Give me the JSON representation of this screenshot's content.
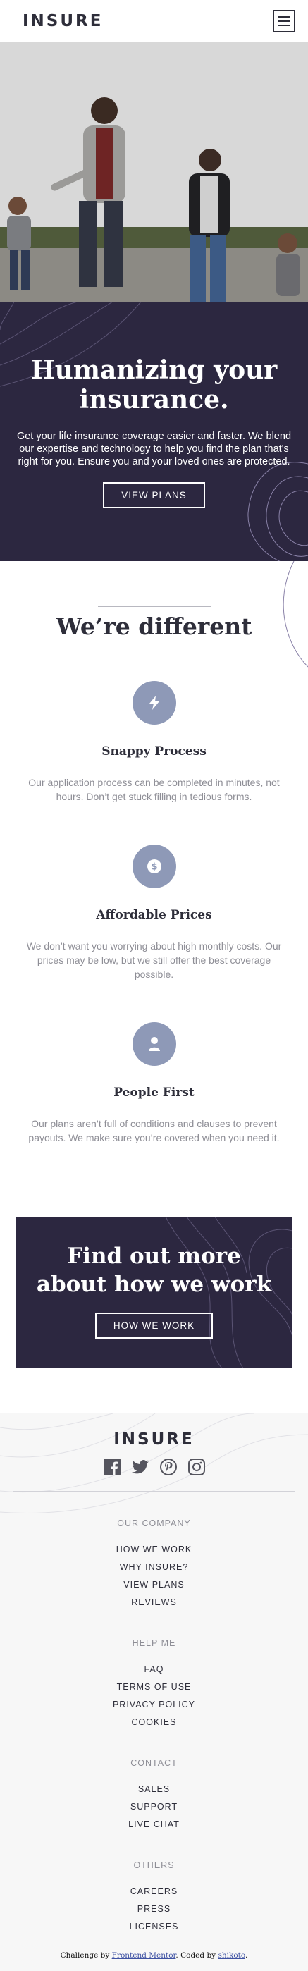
{
  "header": {
    "logo": "INSURE",
    "menu_icon": "hamburger-icon"
  },
  "hero": {
    "title": "Humanizing your insurance.",
    "text": "Get your life insurance coverage easier and faster. We blend our expertise and technology to help you find the plan that's right for you. Ensure you and your loved ones are protected.",
    "button": "VIEW PLANS"
  },
  "different": {
    "title": "We’re different",
    "features": [
      {
        "icon": "lightning-icon",
        "title": "Snappy Process",
        "text": "Our application process can be completed in minutes, not hours. Don’t get stuck filling in tedious forms."
      },
      {
        "icon": "dollar-coin-icon",
        "title": "Affordable Prices",
        "text": "We don’t want you worrying about high monthly costs. Our prices may be low, but we still offer the best coverage possible."
      },
      {
        "icon": "person-icon",
        "title": "People First",
        "text": "Our plans aren’t full of conditions and clauses to prevent payouts. We make sure you’re covered when you need it."
      }
    ]
  },
  "cta": {
    "title": "Find out more about how we work",
    "button": "HOW WE WORK"
  },
  "footer": {
    "logo": "INSURE",
    "socials": [
      "facebook-icon",
      "twitter-icon",
      "pinterest-icon",
      "instagram-icon"
    ],
    "groups": [
      {
        "title": "OUR COMPANY",
        "links": [
          "HOW WE WORK",
          "WHY INSURE?",
          "VIEW PLANS",
          "REVIEWS"
        ]
      },
      {
        "title": "HELP ME",
        "links": [
          "FAQ",
          "TERMS OF USE",
          "PRIVACY POLICY",
          "COOKIES"
        ]
      },
      {
        "title": "CONTACT",
        "links": [
          "SALES",
          "SUPPORT",
          "LIVE CHAT"
        ]
      },
      {
        "title": "OTHERS",
        "links": [
          "CAREERS",
          "PRESS",
          "LICENSES"
        ]
      }
    ],
    "attribution": {
      "prefix": "Challenge by ",
      "link1": "Frontend Mentor",
      "middle": ". Coded by ",
      "link2": "shikoto",
      "suffix": "."
    }
  },
  "colors": {
    "dark_violet": "#2c2740",
    "icon_blue": "#8e99b7",
    "text_gray": "#8e8e96",
    "footer_bg": "#f7f7f7"
  }
}
